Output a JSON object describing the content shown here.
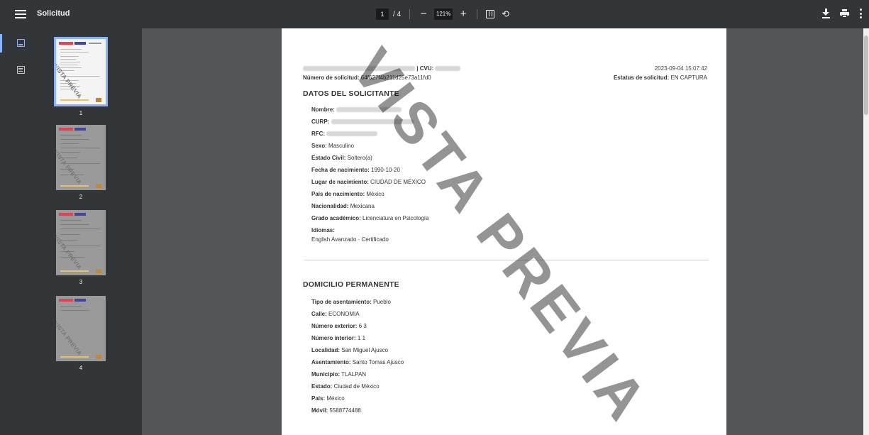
{
  "toolbar": {
    "title": "Solicitud",
    "current_page": "1",
    "page_separator": "/",
    "total_pages": "4",
    "zoom_out": "−",
    "zoom_level": "121%",
    "zoom_in": "+",
    "rotate_glyph": "⟲"
  },
  "thumbnails": [
    {
      "number": "1",
      "watermark": "VISTA PREVIA"
    },
    {
      "number": "2",
      "watermark": "VISTA PREVIA"
    },
    {
      "number": "3",
      "watermark": "VISTA PREVIA"
    },
    {
      "number": "4",
      "watermark": "VISTA PREVIA"
    }
  ],
  "document": {
    "header": {
      "cvu_label": "| CVU:",
      "request_label": "Número de solicitud:",
      "request_value": "64f627f4b211d25e73a11fd0",
      "timestamp": "2023-09-04 15:07:42",
      "status_label": "Estatus de solicitud:",
      "status_value": "EN CAPTURA"
    },
    "watermark": "VISTA PREVIA",
    "applicant": {
      "title": "DATOS DEL SOLICITANTE",
      "fields": [
        {
          "label": "Nombre:",
          "value": ""
        },
        {
          "label": "CURP:",
          "value": ""
        },
        {
          "label": "RFC:",
          "value": ""
        },
        {
          "label": "Sexo:",
          "value": "Masculino"
        },
        {
          "label": "Estado Civil:",
          "value": "Soltero(a)"
        },
        {
          "label": "Fecha de nacimiento:",
          "value": "1990-10-20"
        },
        {
          "label": "Lugar de nacimiento:",
          "value": "CIUDAD DE MÉXICO"
        },
        {
          "label": "País de nacimiento:",
          "value": "México"
        },
        {
          "label": "Nacionalidad:",
          "value": "Mexicana"
        },
        {
          "label": "Grado académico:",
          "value": "Licenciatura en Psicología"
        }
      ],
      "languages_label": "Idiomas:",
      "languages_value": "English Avanzado · Certificado"
    },
    "address": {
      "title": "DOMICILIO PERMANENTE",
      "fields": [
        {
          "label": "Tipo de asentamiento:",
          "value": "Pueblo"
        },
        {
          "label": "Calle:",
          "value": "ECONOMIA"
        },
        {
          "label": "Número exterior:",
          "value": "6 3"
        },
        {
          "label": "Número interior:",
          "value": "1 1"
        },
        {
          "label": "Localidad:",
          "value": "San Miguel Ajusco"
        },
        {
          "label": "Asentamiento:",
          "value": "Santo Tomas Ajusco"
        },
        {
          "label": "Municipio:",
          "value": "TLALPAN"
        },
        {
          "label": "Estado:",
          "value": "Ciudad de México"
        },
        {
          "label": "País:",
          "value": "México"
        },
        {
          "label": "Móvil:",
          "value": "5588774488"
        }
      ]
    }
  },
  "colors": {
    "toolbar_bg": "#323639",
    "viewer_bg": "#525659",
    "accent": "#8ab4f8",
    "page_bg": "#ffffff"
  },
  "icons": [
    "menu-icon",
    "fit-page-icon",
    "rotate-icon",
    "download-icon",
    "print-icon",
    "more-icon",
    "thumbnails-icon",
    "outline-icon"
  ]
}
